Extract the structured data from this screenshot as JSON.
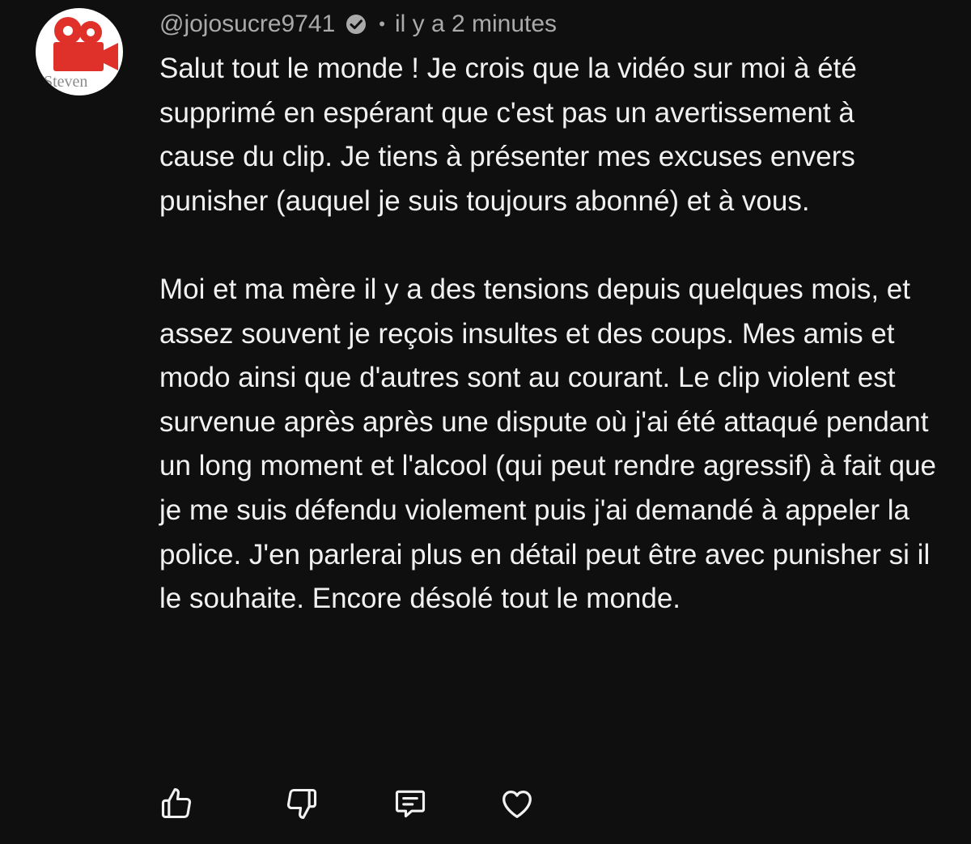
{
  "comment": {
    "avatar_text": "Steven",
    "username": "@jojosucre9741",
    "separator": "•",
    "timestamp": "il y a 2 minutes",
    "paragraphs": [
      "Salut tout le monde ! Je crois que la vidéo sur moi à été supprimé en espérant que c'est pas un avertissement à cause du clip. Je tiens à présenter mes excuses envers punisher (auquel je suis toujours abonné) et à vous.",
      "Moi et ma mère il y a des tensions depuis quelques mois, et assez souvent je reçois insultes et des coups. Mes amis et modo ainsi que d'autres sont au courant. Le clip violent est survenue après après une dispute où j'ai été attaqué pendant un long moment et l'alcool (qui peut rendre agressif) à fait que je me suis défendu violement puis j'ai demandé à appeler la police. J'en parlerai plus en détail peut être avec punisher si il le souhaite. Encore désolé tout le monde."
    ]
  },
  "actions": {
    "like_icon": "thumbs-up-icon",
    "dislike_icon": "thumbs-down-icon",
    "reply_icon": "comment-reply-icon",
    "heart_icon": "heart-icon"
  },
  "colors": {
    "background": "#0f0f0f",
    "text_primary": "#f1f1f1",
    "text_secondary": "#aaaaaa",
    "avatar_red": "#e0302a"
  }
}
